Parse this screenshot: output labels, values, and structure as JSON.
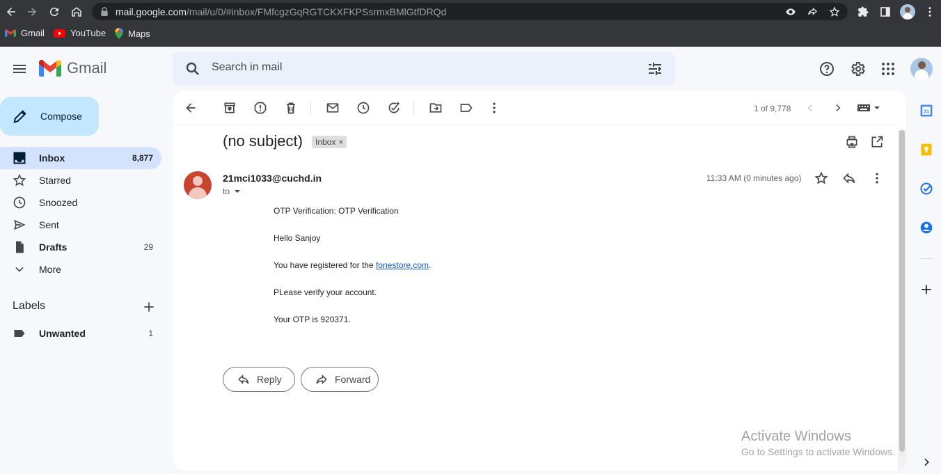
{
  "browser": {
    "url_host": "mail.google.com",
    "url_path": "/mail/u/0/#inbox/FMfcgzGqRGTCKXFKPSsrmxBMlGtfDRQd",
    "bookmarks": [
      {
        "label": "Gmail"
      },
      {
        "label": "YouTube"
      },
      {
        "label": "Maps"
      }
    ]
  },
  "header": {
    "app_name": "Gmail",
    "search_placeholder": "Search in mail"
  },
  "sidebar": {
    "compose_label": "Compose",
    "items": [
      {
        "label": "Inbox",
        "count": "8,877"
      },
      {
        "label": "Starred",
        "count": ""
      },
      {
        "label": "Snoozed",
        "count": ""
      },
      {
        "label": "Sent",
        "count": ""
      },
      {
        "label": "Drafts",
        "count": "29"
      },
      {
        "label": "More",
        "count": ""
      }
    ],
    "labels_title": "Labels",
    "labels": [
      {
        "label": "Unwanted",
        "count": "1"
      }
    ]
  },
  "toolbar": {
    "pager": "1 of 9,778"
  },
  "message": {
    "subject": "(no subject)",
    "label_chip": "Inbox",
    "chip_close": "×",
    "sender": "21mci1033@cuchd.in",
    "to": "to",
    "time": "11:33 AM (0 minutes ago)",
    "body": {
      "line1": "OTP Verification: OTP Verification",
      "line2": "Hello Sanjoy",
      "line3_prefix": "You have registered for the ",
      "line3_link": "fonestore.com",
      "line3_suffix": ".",
      "line4": "PLease verify your account.",
      "line5": "Your OTP is 920371."
    },
    "reply_label": "Reply",
    "forward_label": "Forward"
  },
  "side_panel": {
    "calendar_day": "31"
  },
  "watermark": {
    "title": "Activate Windows",
    "subtitle": "Go to Settings to activate Windows."
  },
  "colors": {
    "accent": "#0b57d0",
    "compose_bg": "#c2e7ff",
    "active_nav": "#d3e3fd",
    "avatar": "#c8442d"
  }
}
